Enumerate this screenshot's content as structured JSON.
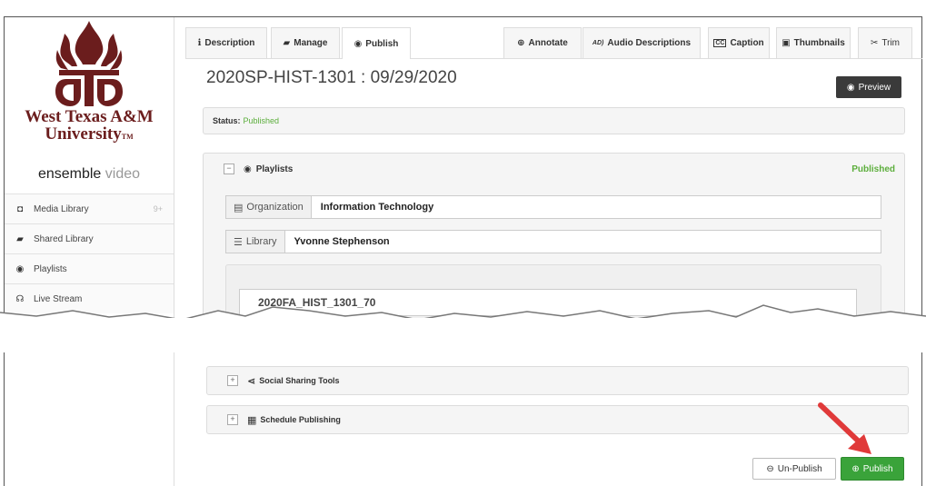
{
  "brand": {
    "name_line1": "West Texas A&M",
    "name_line2": "University",
    "tm": "TM",
    "product_main": "ensemble ",
    "product_sub": "video",
    "colors": {
      "maroon": "#6b1d1d",
      "green": "#3aa33a",
      "status_green": "#5cae3c"
    }
  },
  "sidebar": {
    "items": [
      {
        "label": "Media Library",
        "icon": "media-library-icon",
        "badge": "9+"
      },
      {
        "label": "Shared Library",
        "icon": "folder-icon"
      },
      {
        "label": "Playlists",
        "icon": "globe-icon"
      },
      {
        "label": "Live Stream",
        "icon": "broadcast-icon"
      }
    ]
  },
  "tabs": [
    {
      "label": "Description",
      "icon": "info-icon"
    },
    {
      "label": "Manage",
      "icon": "folder-icon"
    },
    {
      "label": "Publish",
      "icon": "globe-icon",
      "active": true
    },
    {
      "label": "Annotate",
      "icon": "search-plus-icon"
    },
    {
      "label": "Audio Descriptions",
      "icon": "audio-description-icon"
    },
    {
      "label": "Caption",
      "icon": "cc-icon"
    },
    {
      "label": "Thumbnails",
      "icon": "image-icon"
    },
    {
      "label": "Trim",
      "icon": "scissors-icon"
    }
  ],
  "main": {
    "title": "2020SP-HIST-1301 : 09/29/2020",
    "preview_label": "Preview",
    "status_label": "Status:",
    "status_value": "Published",
    "playlists": {
      "header": "Playlists",
      "state": "Published",
      "organization_label": "Organization",
      "organization_value": "Information Technology",
      "library_label": "Library",
      "library_value": "Yvonne Stephenson",
      "playlist_item": "2020FA_HIST_1301_70"
    },
    "social_sharing": "Social Sharing Tools",
    "schedule_publishing": "Schedule Publishing",
    "unpublish_label": "Un-Publish",
    "publish_label": "Publish"
  }
}
